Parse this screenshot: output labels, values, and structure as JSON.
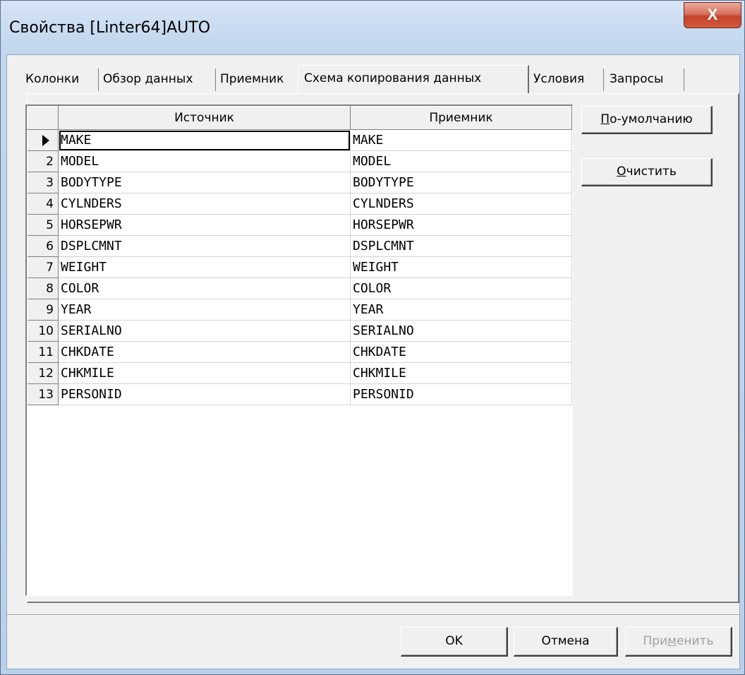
{
  "window": {
    "title": "Свойства [Linter64]AUTO",
    "close_label": "X"
  },
  "tabs": [
    {
      "label": "Колонки"
    },
    {
      "label": "Обзор данных"
    },
    {
      "label": "Приемник"
    },
    {
      "label": "Схема копирования данных",
      "active": true
    },
    {
      "label": "Условия"
    },
    {
      "label": "Запросы"
    }
  ],
  "grid": {
    "columns": [
      "Источник",
      "Приемник"
    ],
    "rows": [
      {
        "num": "",
        "source": "MAKE",
        "target": "MAKE",
        "current": true
      },
      {
        "num": "2",
        "source": "MODEL",
        "target": "MODEL"
      },
      {
        "num": "3",
        "source": "BODYTYPE",
        "target": "BODYTYPE"
      },
      {
        "num": "4",
        "source": "CYLNDERS",
        "target": "CYLNDERS"
      },
      {
        "num": "5",
        "source": "HORSEPWR",
        "target": "HORSEPWR"
      },
      {
        "num": "6",
        "source": "DSPLCMNT",
        "target": "DSPLCMNT"
      },
      {
        "num": "7",
        "source": "WEIGHT",
        "target": "WEIGHT"
      },
      {
        "num": "8",
        "source": "COLOR",
        "target": "COLOR"
      },
      {
        "num": "9",
        "source": "YEAR",
        "target": "YEAR"
      },
      {
        "num": "10",
        "source": "SERIALNO",
        "target": "SERIALNO"
      },
      {
        "num": "11",
        "source": "CHKDATE",
        "target": "CHKDATE"
      },
      {
        "num": "12",
        "source": "CHKMILE",
        "target": "CHKMILE"
      },
      {
        "num": "13",
        "source": "PERSONID",
        "target": "PERSONID"
      }
    ]
  },
  "side_buttons": {
    "default": {
      "first": "П",
      "rest": "о-умолчанию"
    },
    "clear": {
      "first": "О",
      "rest": "чистить"
    }
  },
  "footer": {
    "ok": "OK",
    "cancel": "Отмена",
    "apply": {
      "pre": "При",
      "u": "м",
      "post": "енить"
    }
  }
}
